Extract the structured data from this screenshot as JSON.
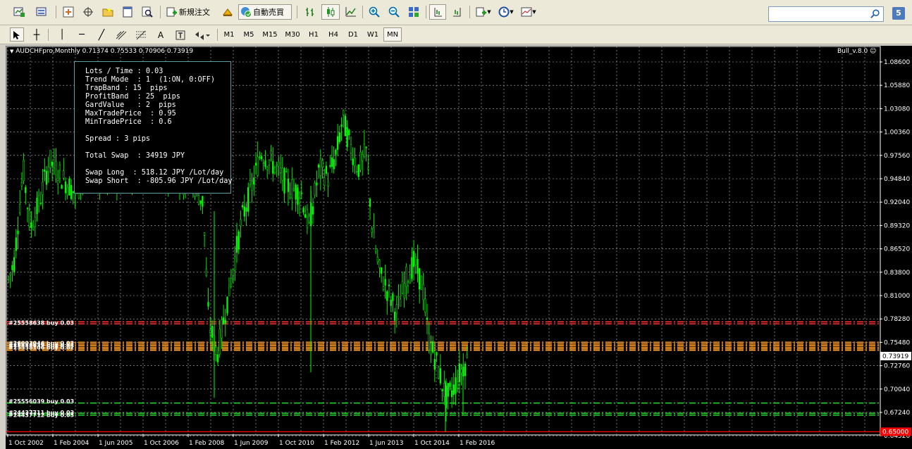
{
  "toolbar": {
    "new_order_label": "新規注文",
    "autotrade_label": "自動売買",
    "notification_count": "5"
  },
  "timeframes": [
    "M1",
    "M5",
    "M15",
    "M30",
    "H1",
    "H4",
    "D1",
    "W1",
    "MN"
  ],
  "active_timeframe": "MN",
  "chart": {
    "symbol_title": "AUDCHFpro,Monthly  0.71374 0.75533 0.70906 0.73919",
    "ea_label": "Bull_v.8.0 ☺",
    "current_price_label": "0.73919",
    "bottom_price_label": "0.65000",
    "y_ticks": [
      "1.08600",
      "1.05880",
      "1.03080",
      "1.00360",
      "0.97560",
      "0.94840",
      "0.92040",
      "0.89320",
      "0.86520",
      "0.83800",
      "0.81000",
      "0.78280",
      "0.75480",
      "0.72760",
      "0.70040",
      "0.67240",
      "0.64520"
    ],
    "x_ticks": [
      "1 Oct 2002",
      "1 Feb 2004",
      "1 Jun 2005",
      "1 Oct 2006",
      "1 Feb 2008",
      "1 Jun 2009",
      "1 Oct 2010",
      "1 Feb 2012",
      "1 Jun 2013",
      "1 Oct 2014",
      "1 Feb 2016"
    ],
    "colors": {
      "candle": "#00ff00",
      "background": "#000000",
      "grid": "#c0c0c0",
      "current_price_bg": "#ffffff",
      "bottom_line": "#ff0000"
    }
  },
  "info_panel": {
    "lines": [
      "Lots / Time : 0.03",
      "Trend Mode  : 1  (1:ON, 0:OFF)",
      "TrapBand : 15  pips",
      "ProfitBand  : 25  pips",
      "GardValue   : 2  pips",
      "MaxTradePrice  : 0.95",
      "MinTradePrice  : 0.6",
      "",
      "Spread : 3 pips",
      "",
      "Total Swap  : 34919 JPY",
      "",
      "Swap Long  : 518.12 JPY /Lot/day",
      "Swap Short  : -805.96 JPY /Lot/day"
    ]
  },
  "order_labels": [
    "#25558638 buy 0.03",
    "#25558639 buy 0.03",
    "#25558106 buy 0.02",
    "#25556039 buy 0.03",
    "#24437711 buy 0.03",
    "#24437712 buy 0.03",
    "#26003046 buy 0.03"
  ]
}
